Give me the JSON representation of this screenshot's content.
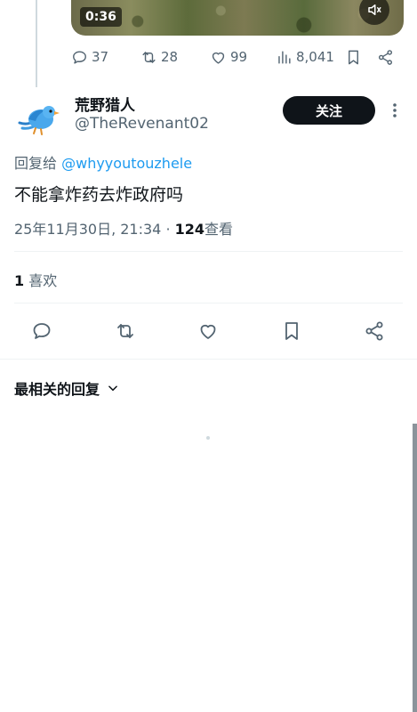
{
  "prev_tweet": {
    "video_time": "0:36",
    "replies": "37",
    "retweets": "28",
    "likes": "99",
    "views": "8,041"
  },
  "author": {
    "name": "荒野猎人",
    "handle": "@TheRevenant02",
    "avatar_icon": "blue-bird-icon",
    "follow_label": "关注"
  },
  "tweet": {
    "reply_prefix": "回复给",
    "reply_mention": "@whyyoutouzhele",
    "text": "不能拿炸药去炸政府吗",
    "timestamp": "25年11月30日, 21:34 · ",
    "views_count": "124",
    "views_label": "查看"
  },
  "likes_row": {
    "count": "1",
    "label": "喜欢"
  },
  "replies_sort": {
    "label": "最相关的回复"
  },
  "colors": {
    "text_primary": "#0f1419",
    "text_secondary": "#536471",
    "link": "#1d9bf0",
    "divider": "#eff3f4"
  }
}
